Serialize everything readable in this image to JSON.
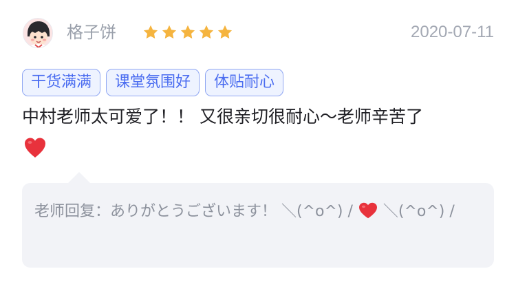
{
  "review": {
    "username": "格子饼",
    "rating": 5,
    "date": "2020-07-11",
    "tags": [
      "干货满满",
      "课堂氛围好",
      "体贴耐心"
    ],
    "comment": "中村老师太可爱了！！ 又很亲切很耐心～老师辛苦了",
    "comment_emoji": "heart-emoji",
    "reply": {
      "label": "老师回复：",
      "text_before_emoji": "ありがとうございます！ ＼(^o^) / ",
      "emoji": "heart-emoji",
      "text_after_emoji": " ＼(^o^) /"
    }
  },
  "colors": {
    "star": "#f5b43f",
    "tag_text": "#4a6cf0",
    "tag_border": "#8fa6f2",
    "tag_bg": "#eef3ff",
    "heart": "#e8323c",
    "reply_bg": "#f2f3f7"
  }
}
